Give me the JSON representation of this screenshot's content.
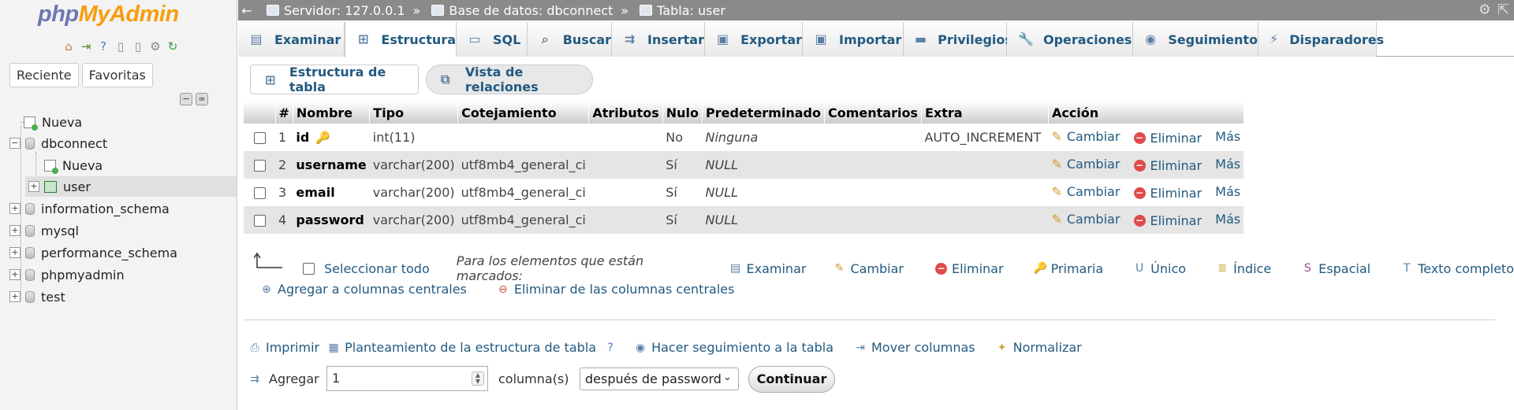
{
  "nav": {
    "logo_php": "php",
    "logo_admin": "MyAdmin",
    "tabs": [
      "Reciente",
      "Favoritas"
    ],
    "tree": {
      "new_top": "Nueva",
      "dbconnect": "dbconnect",
      "new_db": "Nueva",
      "user": "user",
      "information_schema": "information_schema",
      "mysql": "mysql",
      "performance_schema": "performance_schema",
      "phpmyadmin": "phpmyadmin",
      "test": "test"
    }
  },
  "breadcrumb": {
    "server": "Servidor: 127.0.0.1",
    "database": "Base de datos: dbconnect",
    "table": "Tabla: user",
    "separator": "»"
  },
  "tabs": [
    "Examinar",
    "Estructura",
    "SQL",
    "Buscar",
    "Insertar",
    "Exportar",
    "Importar",
    "Privilegios",
    "Operaciones",
    "Seguimiento",
    "Disparadores"
  ],
  "active_tab": "Estructura",
  "subtabs": [
    "Estructura de tabla",
    "Vista de relaciones"
  ],
  "table": {
    "headers": [
      "#",
      "Nombre",
      "Tipo",
      "Cotejamiento",
      "Atributos",
      "Nulo",
      "Predeterminado",
      "Comentarios",
      "Extra",
      "Acción"
    ],
    "rows": [
      {
        "num": "1",
        "name": "id",
        "type": "int(11)",
        "collation": "",
        "attributes": "",
        "null": "No",
        "default": "Ninguna",
        "comments": "",
        "extra": "AUTO_INCREMENT"
      },
      {
        "num": "2",
        "name": "username",
        "type": "varchar(200)",
        "collation": "utf8mb4_general_ci",
        "attributes": "",
        "null": "Sí",
        "default": "NULL",
        "comments": "",
        "extra": ""
      },
      {
        "num": "3",
        "name": "email",
        "type": "varchar(200)",
        "collation": "utf8mb4_general_ci",
        "attributes": "",
        "null": "Sí",
        "default": "NULL",
        "comments": "",
        "extra": ""
      },
      {
        "num": "4",
        "name": "password",
        "type": "varchar(200)",
        "collation": "utf8mb4_general_ci",
        "attributes": "",
        "null": "Sí",
        "default": "NULL",
        "comments": "",
        "extra": ""
      }
    ],
    "actions": {
      "change": "Cambiar",
      "drop": "Eliminar",
      "more": "Más"
    }
  },
  "bulk": {
    "select_all": "Seleccionar todo",
    "marked_label": "Para los elementos que están marcados:",
    "actions": [
      "Examinar",
      "Cambiar",
      "Eliminar",
      "Primaria",
      "Único",
      "Índice",
      "Espacial",
      "Texto completo"
    ],
    "central": [
      "Agregar a columnas centrales",
      "Eliminar de las columnas centrales"
    ]
  },
  "tools": [
    "Imprimir",
    "Planteamiento de la estructura de tabla",
    "Hacer seguimiento a la tabla",
    "Mover columnas",
    "Normalizar"
  ],
  "add_form": {
    "label": "Agregar",
    "count": "1",
    "columns_label": "columna(s)",
    "position": "después de password",
    "submit": "Continuar"
  }
}
